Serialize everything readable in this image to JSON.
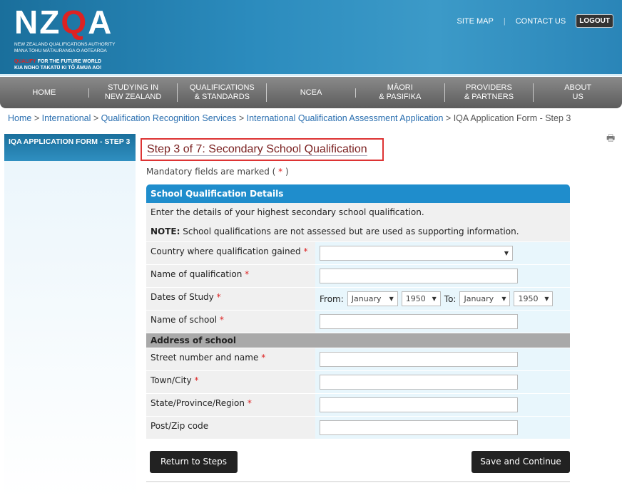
{
  "header": {
    "logo_text": "NZQA",
    "logo_line1": "NEW ZEALAND QUALIFICATIONS AUTHORITY",
    "logo_line2": "MANA TOHU MĀTAURANGA O AOTEAROA",
    "tagline_accent": "QUALIFY",
    "tagline_rest": " FOR THE FUTURE WORLD",
    "tagline2": "KIA NOHO TAKATŪ KI TŌ ĀMUA AO!",
    "site_map": "SITE MAP",
    "contact_us": "CONTACT US",
    "logout": "LOGOUT"
  },
  "nav": [
    "HOME",
    "STUDYING IN\nNEW ZEALAND",
    "QUALIFICATIONS\n& STANDARDS",
    "NCEA",
    "MĀORI\n& PASIFIKA",
    "PROVIDERS\n& PARTNERS",
    "ABOUT\nUS"
  ],
  "breadcrumb": {
    "links": [
      "Home",
      "International",
      "Qualification Recognition Services",
      "International Qualification Assessment Application"
    ],
    "current": "IQA Application Form - Step 3",
    "sep": " > "
  },
  "sidebar": {
    "title": "IQA APPLICATION FORM - STEP 3"
  },
  "page": {
    "title": "Step 3 of 7: Secondary School Qualification",
    "mandatory_prefix": "Mandatory fields are marked ( ",
    "mandatory_star": "*",
    "mandatory_suffix": " )"
  },
  "panel": {
    "title": "School Qualification Details",
    "intro": "Enter the details of your highest secondary school qualification.",
    "note_label": "NOTE:",
    "note_text": " School qualifications are not assessed but are used as supporting information.",
    "fields": {
      "country": "Country where qualification gained",
      "qual_name": "Name of qualification",
      "dates": "Dates of Study",
      "school_name": "Name of school"
    },
    "from_label": "From:",
    "to_label": "To:",
    "from_month": "January",
    "from_year": "1950",
    "to_month": "January",
    "to_year": "1950",
    "address_title": "Address of school",
    "address": {
      "street": "Street number and name",
      "town": "Town/City",
      "state": "State/Province/Region",
      "post": "Post/Zip code"
    },
    "star": "*"
  },
  "buttons": {
    "return": "Return to Steps",
    "save": "Save and Continue"
  }
}
